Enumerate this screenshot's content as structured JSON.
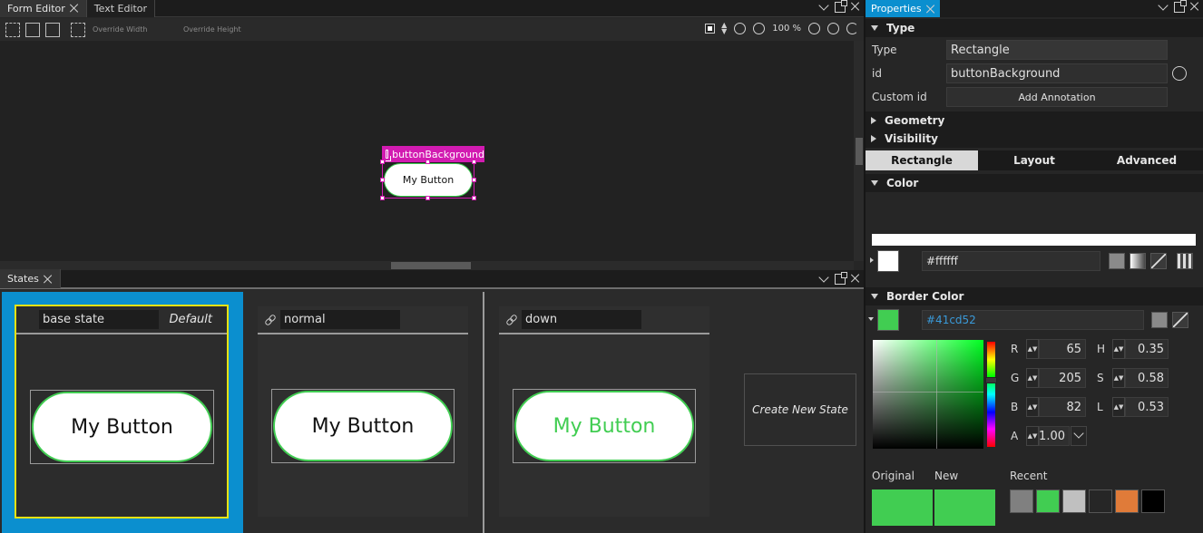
{
  "editor_tabs": [
    {
      "label": "Form Editor",
      "active": true
    },
    {
      "label": "Text Editor",
      "active": false
    }
  ],
  "toolbar": {
    "override_width": "Override Width",
    "override_height": "Override Height",
    "zoom": "100 %"
  },
  "canvas": {
    "selected_id": "buttonBackground",
    "button_text": "My Button"
  },
  "states_panel": {
    "tab_label": "States",
    "states": [
      {
        "name": "base state",
        "tag": "Default",
        "button_text": "My Button",
        "text_color": "#111111"
      },
      {
        "name": "normal",
        "button_text": "My Button",
        "text_color": "#111111"
      },
      {
        "name": "down",
        "button_text": "My Button",
        "text_color": "#41cd52"
      }
    ],
    "create_label": "Create New State"
  },
  "properties": {
    "tab_label": "Properties",
    "type_section": "Type",
    "type_label": "Type",
    "type_value": "Rectangle",
    "id_label": "id",
    "id_value": "buttonBackground",
    "custom_id_label": "Custom id",
    "add_annotation": "Add Annotation",
    "geometry_section": "Geometry",
    "visibility_section": "Visibility",
    "subtabs": [
      "Rectangle",
      "Layout",
      "Advanced"
    ],
    "color_section": "Color",
    "color_value": "#ffffff",
    "border_section": "Border Color",
    "border_value": "#41cd52",
    "rgb": {
      "r_label": "R",
      "r": "65",
      "g_label": "G",
      "g": "205",
      "b_label": "B",
      "b": "82",
      "a_label": "A",
      "a": "1.00"
    },
    "hsl": {
      "h_label": "H",
      "h": "0.35",
      "s_label": "S",
      "s": "0.58",
      "l_label": "L",
      "l": "0.53"
    },
    "original_label": "Original",
    "new_label": "New",
    "recent_label": "Recent",
    "recent_colors": [
      "#808080",
      "#41cd52",
      "#c0c0c0",
      "#262626",
      "#e07b39",
      "#000000"
    ],
    "accent": "#0b8fcf",
    "selection_color": "#d21bb1",
    "active_state_border": "#e6e213"
  }
}
